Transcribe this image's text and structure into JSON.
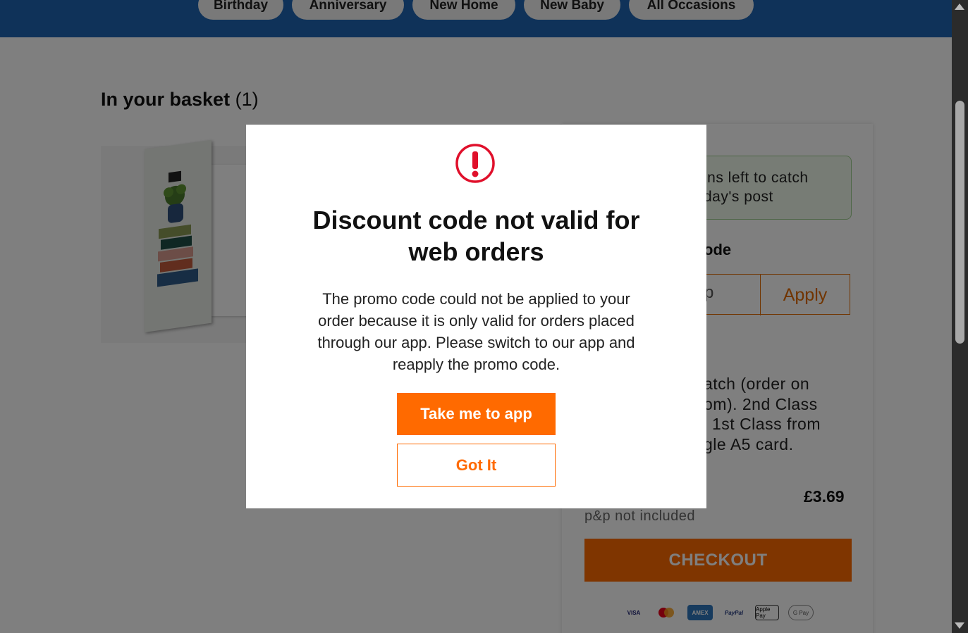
{
  "nav": {
    "categories": [
      "Birthday",
      "Anniversary",
      "New Home",
      "New Baby",
      "All Occasions"
    ]
  },
  "basket": {
    "title_bold": "In your basket",
    "count": "(1)"
  },
  "summary": {
    "post_line1": "ins left to catch",
    "post_line2": "day's post",
    "promo_label": "ode",
    "promo_input_value": "p",
    "apply_label": "Apply",
    "dispatch_lines": [
      "atch (order on",
      "om). 2nd Class",
      "1st Class from",
      "gle A5 card."
    ],
    "price": "£3.69",
    "pp_note": "p&p not included",
    "checkout_label": "CHECKOUT",
    "payment_methods": [
      "VISA",
      "mastercard",
      "AMEX",
      "PayPal",
      "Apple Pay",
      "G Pay"
    ]
  },
  "modal": {
    "icon": "alert-circle-icon",
    "title": "Discount code not valid for web orders",
    "body": "The promo code could not be applied to your order because it is only valid for orders placed through our app. Please switch to our app and reapply the promo code.",
    "primary_label": "Take me to app",
    "secondary_label": "Got It"
  },
  "colors": {
    "brand_blue": "#1f65b3",
    "accent_orange": "#ff6a00",
    "alert_red": "#e0102b"
  }
}
